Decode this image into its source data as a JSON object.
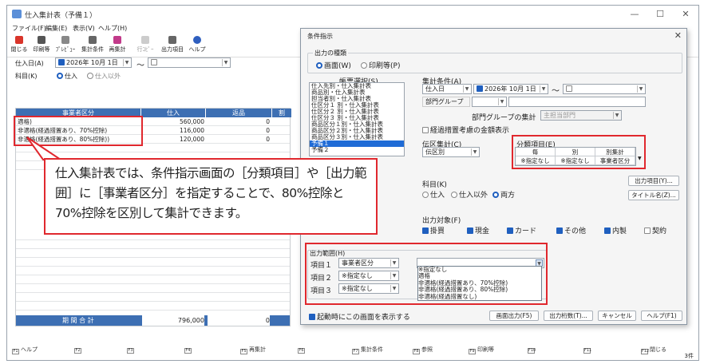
{
  "window": {
    "title": "仕入集計表（予備１）",
    "minimize": "—",
    "maximize": "☐",
    "close": "✕"
  },
  "menu": [
    "ファイル(F)",
    "編集(E)",
    "表示(V)",
    "ヘルプ(H)"
  ],
  "toolbar": [
    {
      "label": "閉じる",
      "icon": "close-doc-icon",
      "color": "#d9352b"
    },
    {
      "label": "印刷等",
      "icon": "printer-icon",
      "color": "#555"
    },
    {
      "label": "ﾌﾟﾚﾋﾞｭｰ",
      "icon": "preview-icon",
      "color": "#777"
    },
    {
      "label": "集計条件",
      "icon": "conditions-icon",
      "color": "#666"
    },
    {
      "label": "再集計",
      "icon": "recalc-icon",
      "color": "#c23a8a"
    },
    {
      "label": "行ｺﾋﾟｰ",
      "icon": "row-copy-icon",
      "color": "#bbb"
    },
    {
      "label": "出力項目",
      "icon": "output-items-icon",
      "color": "#666"
    },
    {
      "label": "ヘルプ",
      "icon": "help-icon",
      "color": "#2f5fbf"
    }
  ],
  "main_filters": {
    "date_label": "仕入日(A)",
    "date_value": "2026年 10月  1日",
    "tilde": "〜",
    "category_label": "科目(K)",
    "opt_purchase": "仕入",
    "opt_other": "仕入以外"
  },
  "grid": {
    "headers": [
      "事業者区分",
      "仕入",
      "返品",
      "割"
    ],
    "rows": [
      [
        "適格)",
        "560,000",
        "0"
      ],
      [
        "非適格(経過措置あり、70%控除)",
        "116,000",
        "0"
      ],
      [
        "非適格(経過措置あり、80%控除))",
        "120,000",
        "0"
      ]
    ],
    "footer_label": "期 間 合 計",
    "footer_value": "796,000",
    "footer_zero": "0"
  },
  "fkeys": [
    "ヘルプ",
    "",
    "",
    "",
    "再集計",
    "",
    "集計条件",
    "参照",
    "印刷等",
    "",
    "",
    "閉じる"
  ],
  "status_count": "3件",
  "callout": "仕入集計表では、条件指示画面の［分類項目］や［出力範囲］に［事業者区分］を指定することで、80%控除と 70%控除を区別して集計できます。",
  "dialog": {
    "title": "条件指示",
    "output_type_label": "出力の種類",
    "opt_screen": "画面(W)",
    "opt_print": "印刷等(P)",
    "form_select_label": "帳票選択(S)",
    "forms": [
      "仕入先別・仕入集計表",
      "商品別・仕入集計表",
      "担当者別・仕入集計表",
      "仕区分１ 別・仕入集計表",
      "仕区分２ 別・仕入集計表",
      "仕区分３ 別・仕入集計表",
      "商品区分１別・仕入集計表",
      "商品区分２別・仕入集計表",
      "商品区分３別・仕入集計表",
      "予備１",
      "予備２"
    ],
    "selected_form": "予備１",
    "agg_cond_label": "集計条件(A)",
    "date_field": "仕入日",
    "date_value": "2026年 10月  1日",
    "tilde": "〜",
    "dept_group": "部門グループ",
    "dept_group_agg": "部門グループの集計",
    "dept_group_agg_value": "主担当部門",
    "transitional_chk": "経過措置考慮の金額表示",
    "slip_agg_label": "伝区集計(C)",
    "slip_agg_value": "伝区別",
    "class_label": "分類項目(E)",
    "class_headers": [
      "毎",
      "別",
      "別集計"
    ],
    "class_values": [
      "※指定なし",
      "※指定なし",
      "事業者区分"
    ],
    "output_items_btn": "出力項目(Y)...",
    "title_btn": "タイトル名(Z)...",
    "subject_label": "科目(K)",
    "subj_purchase": "仕入",
    "subj_other": "仕入以外",
    "subj_both": "両方",
    "output_target_label": "出力対象(F)",
    "targets": [
      "掛買",
      "現金",
      "カード",
      "その他",
      "内製",
      "契約"
    ],
    "targets_checked": [
      true,
      true,
      true,
      true,
      true,
      false
    ],
    "range_label": "出力範囲(H)",
    "range_items": [
      {
        "name": "項目１",
        "value": "事業者区分"
      },
      {
        "name": "項目２",
        "value": "※指定なし"
      },
      {
        "name": "項目３",
        "value": "※指定なし"
      }
    ],
    "range_dropdown": [
      "※指定なし",
      "適格",
      "非適格(経過措置あり、70%控除)",
      "非適格(経過措置あり、80%控除)",
      "非適格(経過措置なし)"
    ],
    "startup_chk": "起動時にこの画面を表示する",
    "btn_screen": "画面出力(F5)",
    "btn_digits": "出力桁数(T)...",
    "btn_cancel": "キャンセル",
    "btn_help": "ヘルプ(F1)"
  },
  "colors": {
    "accent": "#1f5fbf",
    "header": "#3d6fb3",
    "highlight": "#e0282e"
  }
}
